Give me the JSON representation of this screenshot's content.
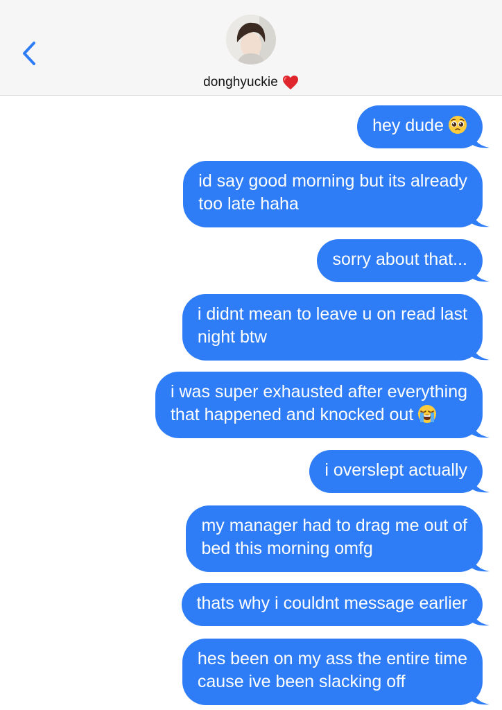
{
  "header": {
    "back_icon": "chevron-left-icon",
    "avatar_icon": "contact-photo",
    "contact_name": "donghyuckie",
    "contact_emoji": "red-heart-icon"
  },
  "colors": {
    "bubble": "#2f7df6",
    "header_bg": "#f6f6f6",
    "accent": "#2f7df6"
  },
  "messages": [
    {
      "lines": [
        "hey dude"
      ],
      "emoji": "pleading-face-icon"
    },
    {
      "lines": [
        "id say good morning but its already",
        "too late haha"
      ]
    },
    {
      "lines": [
        "sorry about that..."
      ]
    },
    {
      "lines": [
        "i didnt mean to leave u on read last",
        "night btw"
      ]
    },
    {
      "lines": [
        "i was super exhausted after everything",
        "that happened and knocked out"
      ],
      "emoji": "loudly-crying-face-icon"
    },
    {
      "lines": [
        "i overslept actually"
      ]
    },
    {
      "lines": [
        "my manager had to drag me out of",
        "bed this morning omfg"
      ]
    },
    {
      "lines": [
        "thats why i couldnt message earlier"
      ]
    },
    {
      "lines": [
        "hes been on my ass the entire time",
        "cause ive been slacking off"
      ]
    }
  ]
}
